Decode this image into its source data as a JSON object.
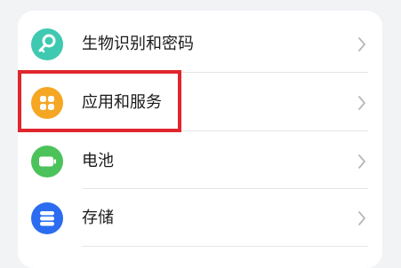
{
  "settings": {
    "items": [
      {
        "label": "生物识别和密码",
        "icon": "key-icon",
        "color": "#3ec9b0"
      },
      {
        "label": "应用和服务",
        "icon": "apps-grid-icon",
        "color": "#f5a623"
      },
      {
        "label": "电池",
        "icon": "battery-icon",
        "color": "#4cc25b"
      },
      {
        "label": "存储",
        "icon": "storage-icon",
        "color": "#2b6cf0"
      }
    ]
  },
  "highlight": {
    "color": "#e0262d",
    "target": "应用和服务"
  }
}
